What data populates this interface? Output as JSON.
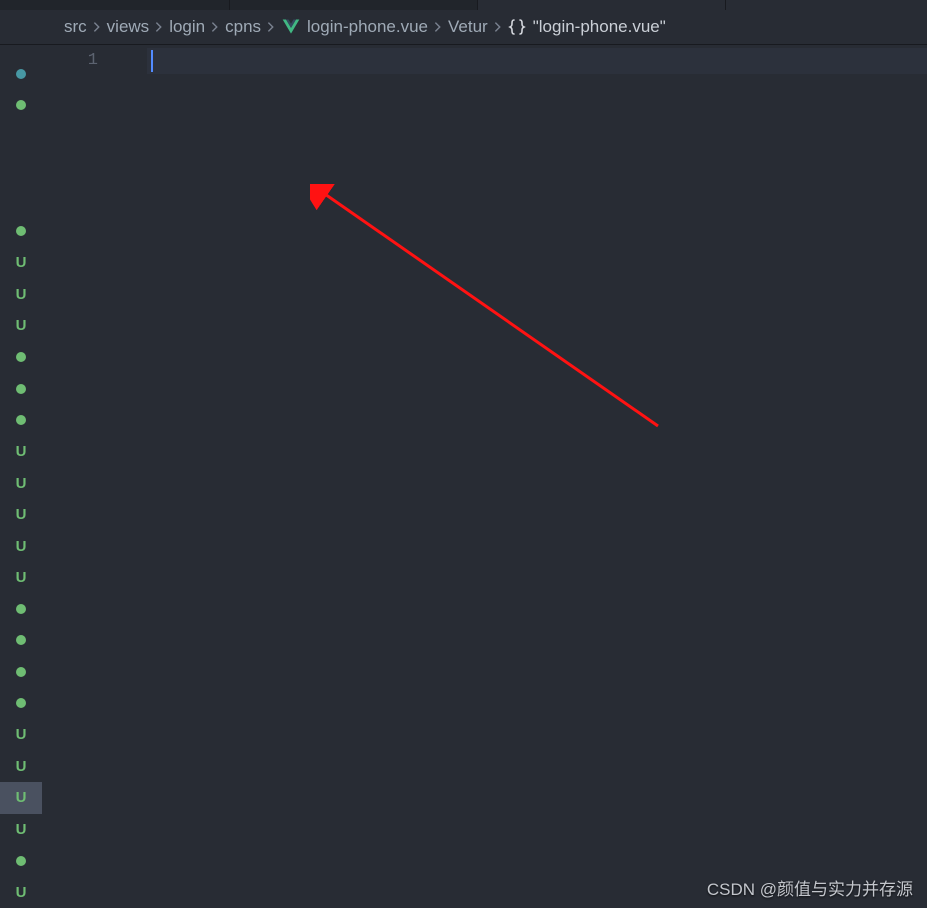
{
  "breadcrumb": {
    "items": [
      {
        "label": "src"
      },
      {
        "label": "views"
      },
      {
        "label": "login"
      },
      {
        "label": "cpns"
      },
      {
        "label": "login-phone.vue",
        "icon": "vue"
      },
      {
        "label": "Vetur"
      },
      {
        "label": "\"login-phone.vue\"",
        "icon": "braces"
      }
    ]
  },
  "editor": {
    "line_numbers": [
      "1"
    ],
    "file_name": "login-phone.vue"
  },
  "gutter": {
    "markers": [
      {
        "type": "dot-teal"
      },
      {
        "type": "dot-green"
      },
      {
        "type": "spacer"
      },
      {
        "type": "spacer"
      },
      {
        "type": "spacer"
      },
      {
        "type": "dot-green"
      },
      {
        "type": "u",
        "label": "U"
      },
      {
        "type": "u",
        "label": "U"
      },
      {
        "type": "u",
        "label": "U"
      },
      {
        "type": "dot-green"
      },
      {
        "type": "dot-green"
      },
      {
        "type": "dot-green"
      },
      {
        "type": "u",
        "label": "U"
      },
      {
        "type": "u",
        "label": "U"
      },
      {
        "type": "u",
        "label": "U"
      },
      {
        "type": "u",
        "label": "U"
      },
      {
        "type": "u",
        "label": "U"
      },
      {
        "type": "dot-green"
      },
      {
        "type": "dot-green"
      },
      {
        "type": "dot-green"
      },
      {
        "type": "dot-green"
      },
      {
        "type": "u",
        "label": "U"
      },
      {
        "type": "u",
        "label": "U"
      },
      {
        "type": "u",
        "label": "U",
        "selected": true
      },
      {
        "type": "u",
        "label": "U"
      },
      {
        "type": "dot-green"
      },
      {
        "type": "u",
        "label": "U"
      }
    ]
  },
  "watermark": {
    "text": "CSDN @颜值与实力并存源"
  }
}
